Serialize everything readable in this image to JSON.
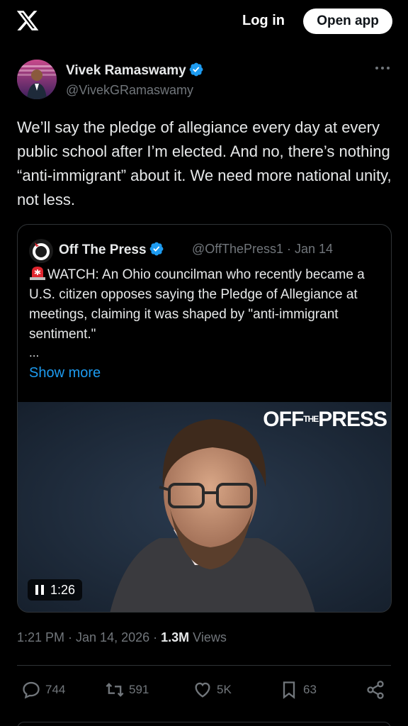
{
  "header": {
    "logo": "x-logo-icon",
    "login_label": "Log in",
    "open_app_label": "Open app"
  },
  "post": {
    "author_name": "Vivek Ramaswamy",
    "author_handle": "@VivekGRamaswamy",
    "text": "We’ll say the pledge of allegiance every day at every public school after I’m elected. And no, there’s nothing “anti-immigrant” about it. We need more national unity, not less.",
    "timestamp": "1:21 PM · Jan 14, 2026 · ",
    "views_count": "1.3M",
    "views_label": " Views"
  },
  "quoted": {
    "author_name": "Off The Press",
    "author_handle": "@OffThePress1",
    "date": "Jan 14",
    "text": "WATCH: An Ohio councilman who recently became a U.S. citizen opposes saying the Pledge of Allegiance at meetings, claiming it was shaped by \"anti-immigrant sentiment.\"",
    "ellipsis": "...",
    "show_more": "Show more",
    "video_watermark": "OFF THE PRESS",
    "video_duration": "1:26"
  },
  "actions": {
    "replies": "744",
    "reposts": "591",
    "likes": "5K",
    "bookmarks": "63"
  },
  "colors": {
    "background": "#000000",
    "accent": "#1d9bf0",
    "muted": "#71767b",
    "text": "#e7e9ea"
  }
}
